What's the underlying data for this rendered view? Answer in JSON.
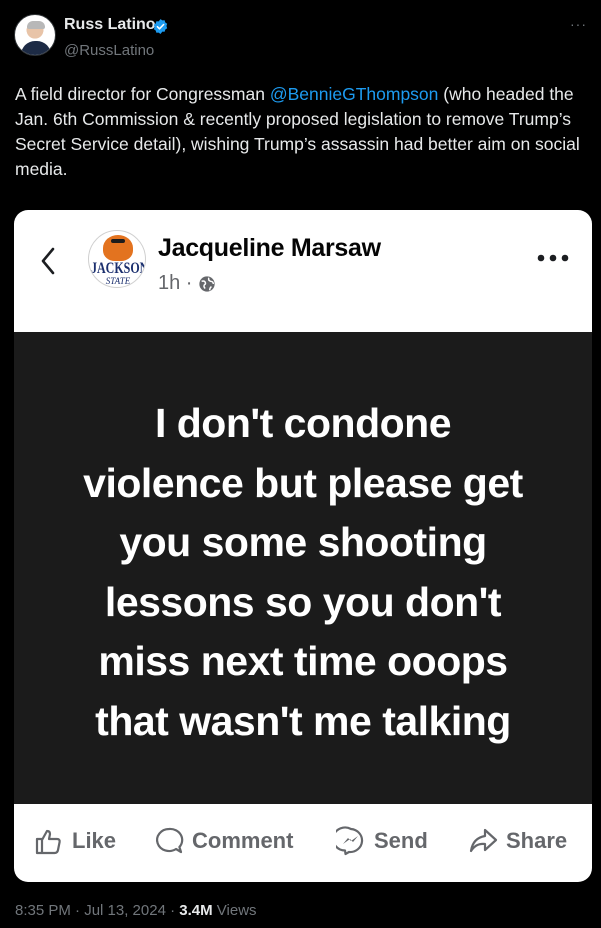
{
  "tweet": {
    "author_name": "Russ Latino",
    "handle": "@RussLatino",
    "more_label": "···",
    "text_before": "A field director for Congressman ",
    "mention": "@BennieGThompson",
    "text_after": " (who headed the Jan. 6th Commission & recently proposed legislation to remove Trump’s Secret Service detail), wishing Trump’s assassin had better aim on social media.",
    "time": "8:35 PM · Jul 13, 2024 · ",
    "views_count": "3.4M",
    "views_label": " Views"
  },
  "fb_post": {
    "name": "Jacqueline Marsaw",
    "time": "1h ·",
    "avatar_text_top": "JACKSON",
    "avatar_text_bottom": "STATE",
    "body": "I don't condone\nviolence but please get\nyou some  shooting\nlessons so you don't\nmiss next time ooops\nthat wasn't me talking",
    "actions": {
      "like": "Like",
      "comment": "Comment",
      "send": "Send",
      "share": "Share"
    }
  },
  "colors": {
    "background": "#000000",
    "mention": "#1d9bf0",
    "verified_badge": "#1d9bf0",
    "fb_post_background": "#1b1b1b",
    "fb_action_gray": "#65676b"
  },
  "icons": [
    "verified-badge-icon",
    "back-chevron-icon",
    "globe-icon",
    "more-dots-icon",
    "like-thumb-icon",
    "comment-bubble-icon",
    "messenger-send-icon",
    "share-arrow-icon"
  ]
}
